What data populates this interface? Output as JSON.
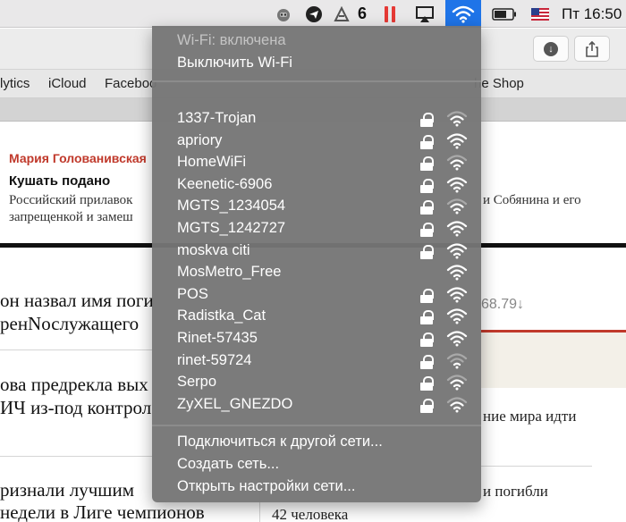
{
  "menubar": {
    "badge_count": "6",
    "clock": "Пт 16:50"
  },
  "bookmarks": [
    "lytics",
    "iCloud",
    "Faceboo",
    "he Shop"
  ],
  "article": {
    "author": "Мария Голованивская",
    "title": "Кушать подано",
    "text_line1": "Российский прилавок",
    "text_line2": "запрещенкой и замеш",
    "text_right": "и Собянина и его"
  },
  "headlines": {
    "h1_line1": "он назвал имя поги",
    "h1_line2": "ренNослужащего",
    "h2_line1": "ова предрекла вых",
    "h2_line2": "ИЧ из-под контрол",
    "h3_line1": "ризнали лучшим",
    "h3_line2": " недели в Лиге чемпионов"
  },
  "sidebar": {
    "rate": "68.79↓",
    "item1": "ние мира идти",
    "item2": "и погибли",
    "item3": "42 человека"
  },
  "wifi": {
    "status": "Wi-Fi: включена",
    "toggle": "Выключить Wi-Fi",
    "networks": [
      {
        "name": "1337-Trojan",
        "locked": true,
        "strength": 2
      },
      {
        "name": "apriory",
        "locked": true,
        "strength": 3
      },
      {
        "name": "HomeWiFi",
        "locked": true,
        "strength": 2
      },
      {
        "name": "Keenetic-6906",
        "locked": true,
        "strength": 3
      },
      {
        "name": "MGTS_1234054",
        "locked": true,
        "strength": 2
      },
      {
        "name": "MGTS_1242727",
        "locked": true,
        "strength": 3
      },
      {
        "name": "moskva citi",
        "locked": true,
        "strength": 3
      },
      {
        "name": "MosMetro_Free",
        "locked": false,
        "strength": 3
      },
      {
        "name": "POS",
        "locked": true,
        "strength": 3
      },
      {
        "name": "Radistka_Cat",
        "locked": true,
        "strength": 3
      },
      {
        "name": "Rinet-57435",
        "locked": true,
        "strength": 3
      },
      {
        "name": "rinet-59724",
        "locked": true,
        "strength": 1
      },
      {
        "name": "Serpo",
        "locked": true,
        "strength": 2
      },
      {
        "name": "ZyXEL_GNEZDO",
        "locked": true,
        "strength": 2
      }
    ],
    "other_network": "Подключиться к другой сети...",
    "create_network": "Создать сеть...",
    "open_settings": "Открыть настройки сети..."
  }
}
